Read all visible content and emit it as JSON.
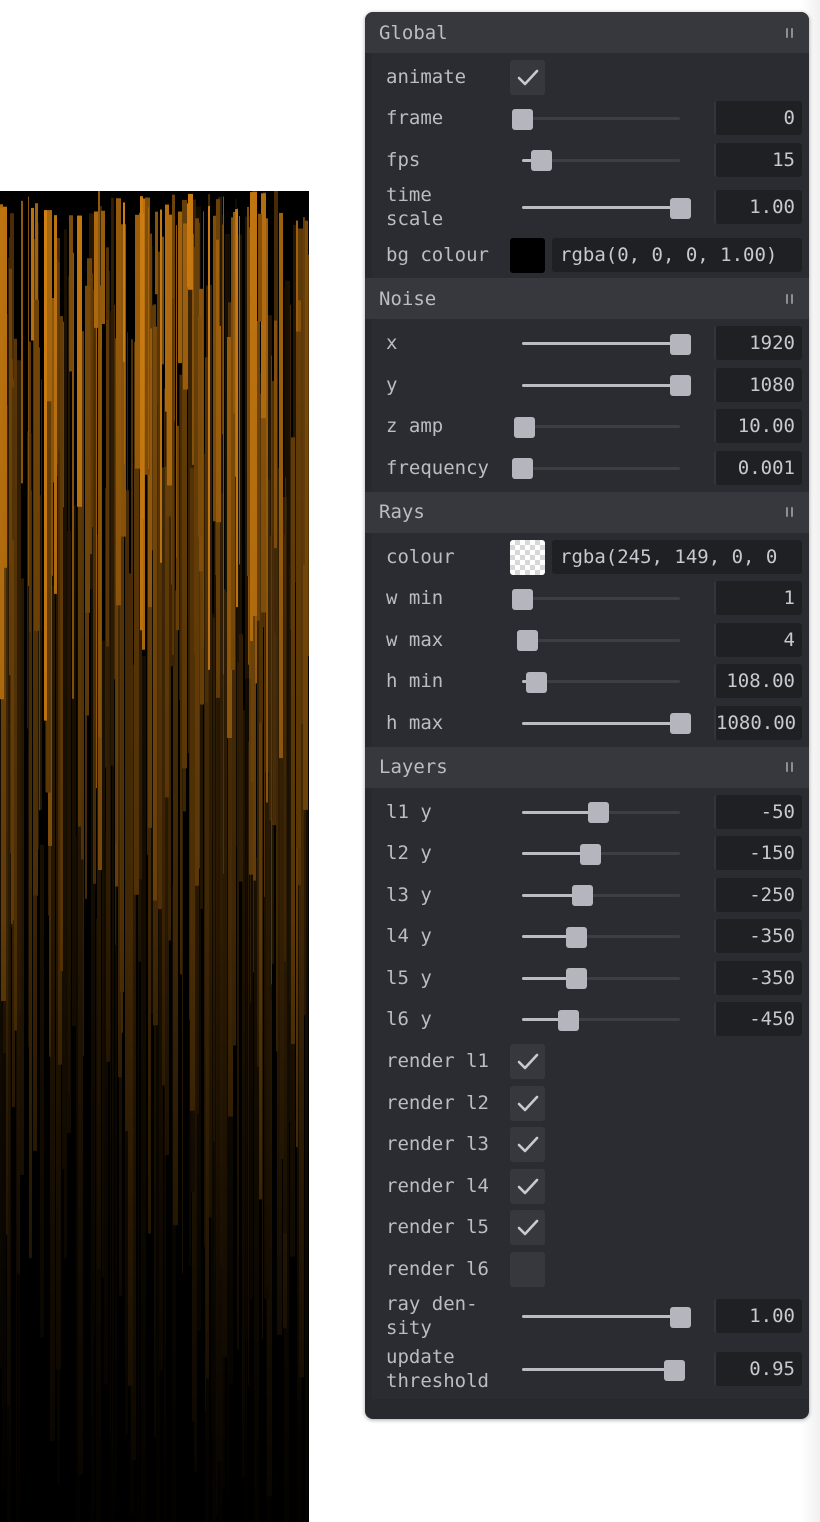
{
  "folders": [
    {
      "title": "Global",
      "rows": [
        {
          "type": "checkbox",
          "label": "animate",
          "checked": true
        },
        {
          "type": "slider",
          "label": "frame",
          "value": "0",
          "pos": 0
        },
        {
          "type": "slider",
          "label": "fps",
          "value": "15",
          "pos": 0.12
        },
        {
          "type": "slider",
          "label": "time scale",
          "label_lines": [
            "time",
            "scale"
          ],
          "value": "1.00",
          "pos": 1
        },
        {
          "type": "color",
          "label": "bg colour",
          "value": "rgba(0, 0, 0, 1.00)",
          "swatch": "#000000"
        }
      ]
    },
    {
      "title": "Noise",
      "rows": [
        {
          "type": "slider",
          "label": "x",
          "value": "1920",
          "pos": 1
        },
        {
          "type": "slider",
          "label": "y",
          "value": "1080",
          "pos": 1
        },
        {
          "type": "slider",
          "label": "z amp",
          "value": "10.00",
          "pos": 0.01
        },
        {
          "type": "slider",
          "label": "frequency",
          "value": "0.001",
          "pos": 0
        }
      ]
    },
    {
      "title": "Rays",
      "rows": [
        {
          "type": "color",
          "label": "colour",
          "value": "rgba(245, 149, 0, 0",
          "swatch": "checker"
        },
        {
          "type": "slider",
          "label": "w min",
          "value": "1",
          "pos": 0
        },
        {
          "type": "slider",
          "label": "w max",
          "value": "4",
          "pos": 0.03
        },
        {
          "type": "slider",
          "label": "h min",
          "value": "108.00",
          "pos": 0.09
        },
        {
          "type": "slider",
          "label": "h max",
          "value": "1080.00",
          "pos": 1
        }
      ]
    },
    {
      "title": "Layers",
      "rows": [
        {
          "type": "slider",
          "label": "l1 y",
          "value": "-50",
          "pos": 0.48
        },
        {
          "type": "slider",
          "label": "l2 y",
          "value": "-150",
          "pos": 0.43
        },
        {
          "type": "slider",
          "label": "l3 y",
          "value": "-250",
          "pos": 0.38
        },
        {
          "type": "slider",
          "label": "l4 y",
          "value": "-350",
          "pos": 0.34
        },
        {
          "type": "slider",
          "label": "l5 y",
          "value": "-350",
          "pos": 0.34
        },
        {
          "type": "slider",
          "label": "l6 y",
          "value": "-450",
          "pos": 0.29
        },
        {
          "type": "checkbox",
          "label": "render l1",
          "checked": true
        },
        {
          "type": "checkbox",
          "label": "render l2",
          "checked": true
        },
        {
          "type": "checkbox",
          "label": "render l3",
          "checked": true
        },
        {
          "type": "checkbox",
          "label": "render l4",
          "checked": true
        },
        {
          "type": "checkbox",
          "label": "render l5",
          "checked": true
        },
        {
          "type": "checkbox",
          "label": "render l6",
          "checked": false
        },
        {
          "type": "slider",
          "label": "ray density",
          "label_lines": [
            "ray den-",
            "sity"
          ],
          "value": "1.00",
          "pos": 1
        },
        {
          "type": "slider",
          "label": "update threshold",
          "label_lines": [
            "update",
            "threshold"
          ],
          "value": "0.95",
          "pos": 0.96
        }
      ]
    }
  ],
  "art": {
    "ray_colour": "#f59500",
    "background": "#000000"
  }
}
